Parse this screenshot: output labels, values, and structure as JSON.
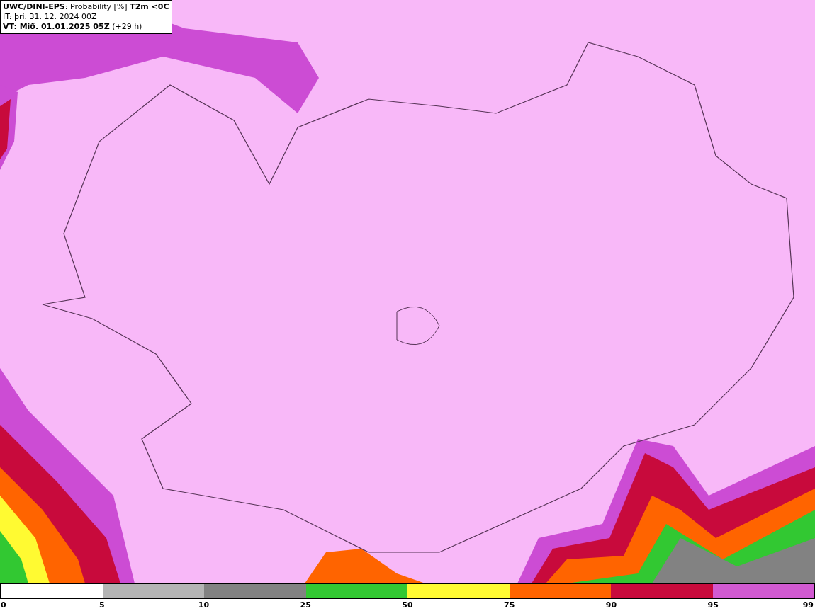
{
  "header": {
    "lines": [
      "**UWC/DINI-EPS**: Probability [%] **T2m <0C**",
      "IT: þri. 31. 12. 2024 00Z",
      "**VT: Mið. 01.01.2025 05Z** (+29 h)"
    ]
  },
  "legend": {
    "first_tick": "0",
    "segments": [
      {
        "color": "#ffffff",
        "tick": "5"
      },
      {
        "color": "#b4b4b4",
        "tick": "10"
      },
      {
        "color": "#828282",
        "tick": "25"
      },
      {
        "color": "#32c832",
        "tick": "50"
      },
      {
        "color": "#fffa32",
        "tick": "75"
      },
      {
        "color": "#ff6400",
        "tick": "90"
      },
      {
        "color": "#c80a3c",
        "tick": "95"
      },
      {
        "color": "#d25ad2",
        "tick": "99"
      }
    ]
  }
}
